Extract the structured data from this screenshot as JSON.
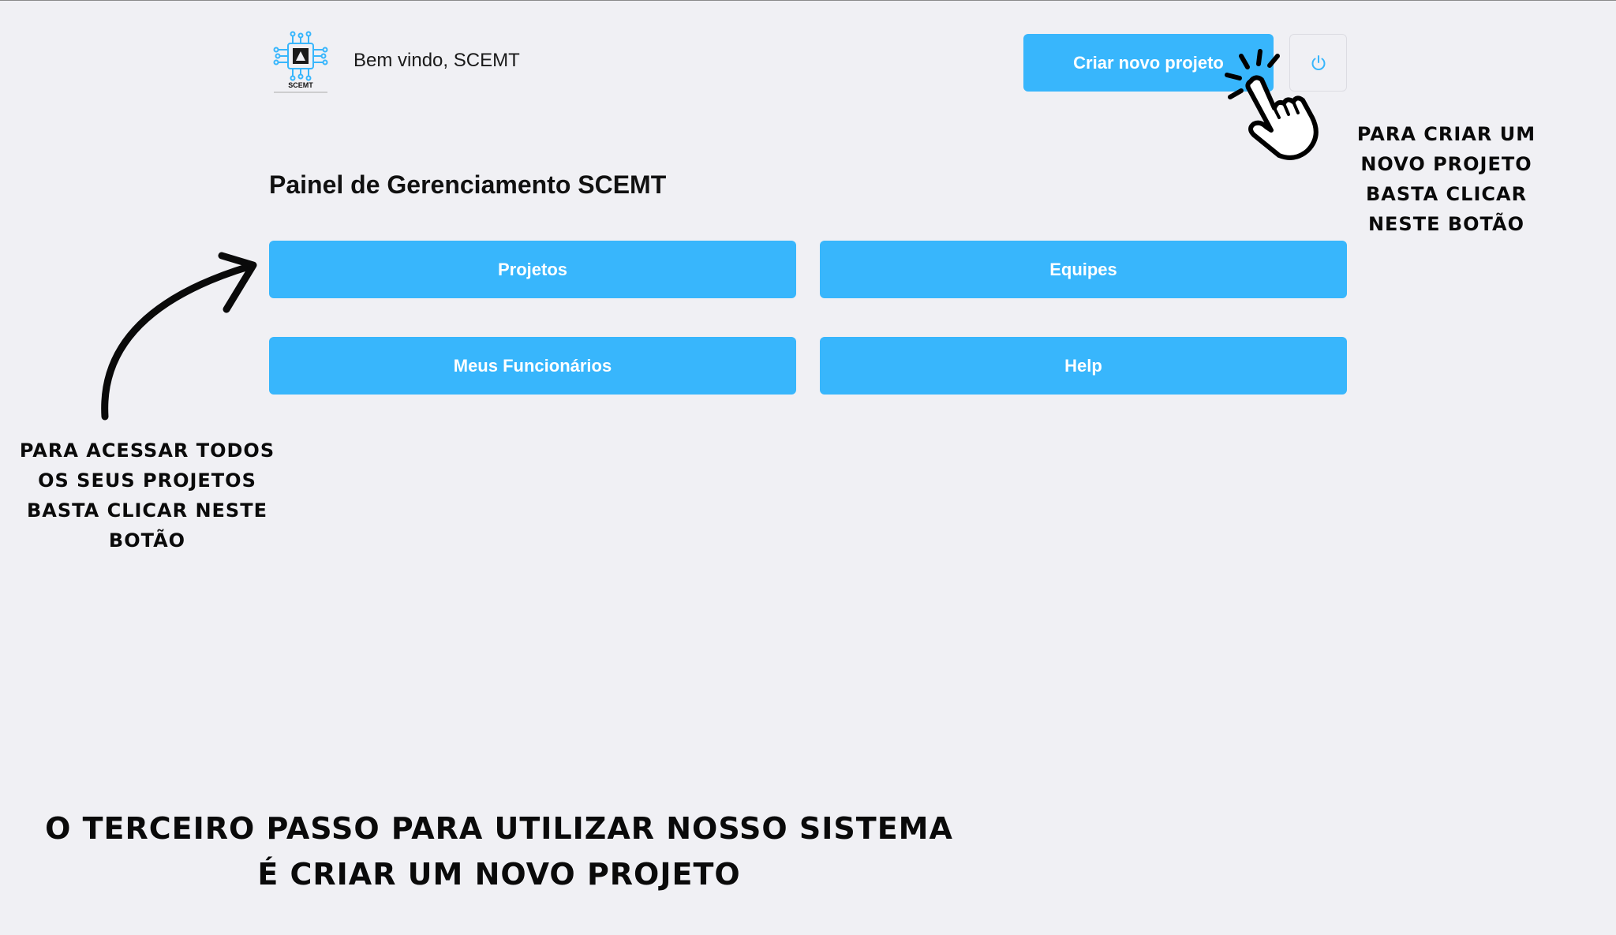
{
  "header": {
    "logo_text": "SCEMT",
    "welcome": "Bem vindo, SCEMT",
    "create_button": "Criar novo projeto",
    "power_icon": "power-icon"
  },
  "main": {
    "title": "Painel de Gerenciamento SCEMT",
    "buttons": [
      {
        "label": "Projetos"
      },
      {
        "label": "Equipes"
      },
      {
        "label": "Meus Funcionários"
      },
      {
        "label": "Help"
      }
    ]
  },
  "annotations": {
    "right_lines": [
      "Para criar um",
      "novo projeto",
      "basta clicar",
      "neste botão"
    ],
    "left_lines": [
      "Para acessar todos",
      "os seus projetos",
      "basta clicar neste",
      "botão"
    ],
    "bottom_lines": [
      "O terceiro passo para utilizar nosso sistema",
      "é criar um novo projeto"
    ]
  },
  "colors": {
    "accent": "#38b6fc",
    "background": "#f0f0f4"
  }
}
